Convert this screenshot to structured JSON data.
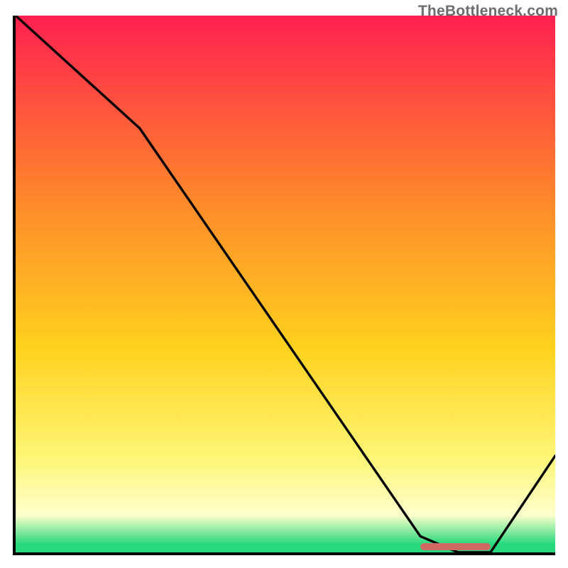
{
  "watermark": "TheBottleneck.com",
  "colors": {
    "top": "#ff2050",
    "mid1": "#ff8a2a",
    "mid2": "#ffd21e",
    "mid3": "#fff574",
    "mid4": "#ffffcc",
    "green": "#27d97c",
    "axis": "#000000",
    "curve": "#000000",
    "marker": "#cf6a62"
  },
  "chart_data": {
    "type": "line",
    "title": "",
    "xlabel": "",
    "ylabel": "",
    "xlim": [
      0,
      100
    ],
    "ylim": [
      0,
      100
    ],
    "x": [
      0,
      23,
      75,
      82,
      88,
      100
    ],
    "values": [
      100,
      79,
      3,
      0,
      0,
      18
    ],
    "marker_x_range": [
      75,
      88
    ],
    "marker_y": 0,
    "grid": false,
    "legend": false
  }
}
